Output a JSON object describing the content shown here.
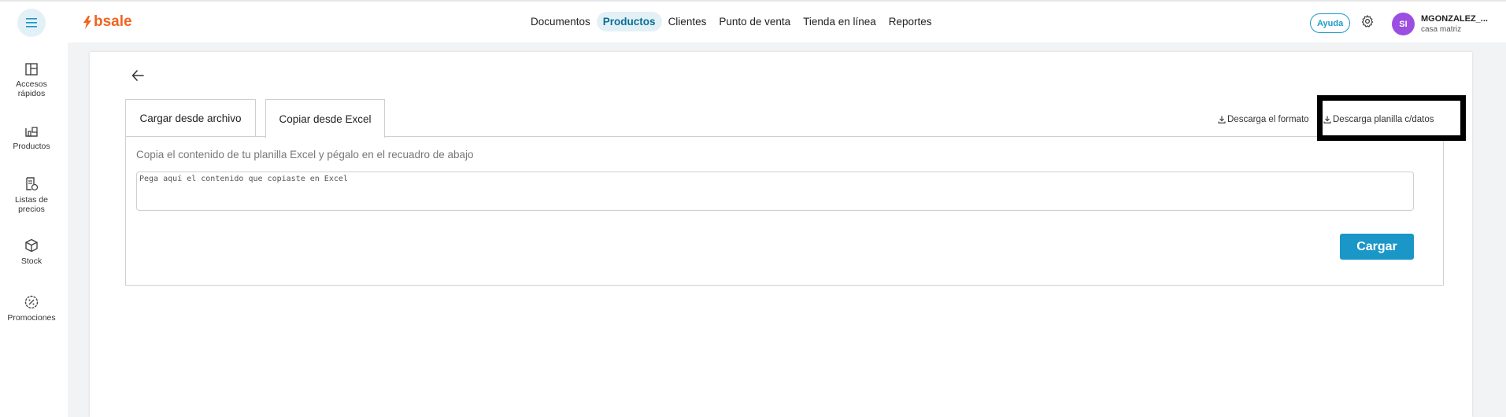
{
  "header": {
    "logo_text": "bsale",
    "nav": [
      {
        "label": "Documentos",
        "active": false
      },
      {
        "label": "Productos",
        "active": true
      },
      {
        "label": "Clientes",
        "active": false
      },
      {
        "label": "Punto de venta",
        "active": false
      },
      {
        "label": "Tienda en línea",
        "active": false
      },
      {
        "label": "Reportes",
        "active": false
      }
    ],
    "help_label": "Ayuda",
    "user": {
      "initials": "SI",
      "name": "MGONZALEZ_...",
      "branch": "casa matriz"
    }
  },
  "sidebar": {
    "items": [
      {
        "label": "Accesos rápidos",
        "icon": "layout-icon"
      },
      {
        "label": "Productos",
        "icon": "products-icon"
      },
      {
        "label": "Listas de precios",
        "icon": "price-list-icon"
      },
      {
        "label": "Stock",
        "icon": "box-icon"
      },
      {
        "label": "Promociones",
        "icon": "promo-icon"
      }
    ]
  },
  "main": {
    "tabs": [
      {
        "label": "Cargar desde archivo",
        "active": false
      },
      {
        "label": "Copiar desde Excel",
        "active": true
      }
    ],
    "download_format_label": "Descarga el formato",
    "download_with_data_label": "Descarga planilla c/datos",
    "instructions": "Copia el contenido de tu planilla Excel y pégalo en el recuadro de abajo",
    "paste_placeholder": "Pega aquí el contenido que copiaste en Excel",
    "upload_label": "Cargar"
  },
  "colors": {
    "accent": "#1a96c7",
    "brand": "#f26322",
    "avatar": "#9b4ee0",
    "nav_active_bg": "#e3f1f7"
  }
}
